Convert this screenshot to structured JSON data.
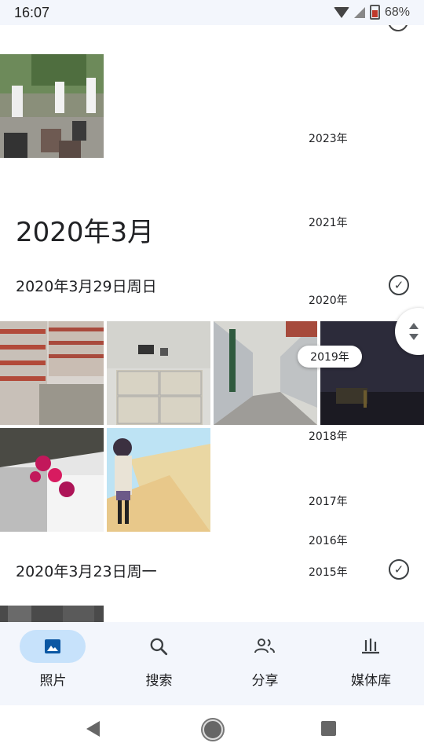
{
  "status_bar": {
    "time": "16:07",
    "battery": "68%",
    "icons": [
      "wifi-icon",
      "cellular-icon",
      "battery-icon"
    ]
  },
  "sections": [
    {
      "month": "2020年3月",
      "days": [
        {
          "label": "2020年3月29日周日",
          "photo_count": 6
        },
        {
          "label": "2020年3月23日周一",
          "photo_count": 1
        }
      ]
    }
  ],
  "year_scrubber": {
    "years": [
      "2023年",
      "2021年",
      "2020年",
      "2019年",
      "2018年",
      "2017年",
      "2016年",
      "2015年"
    ],
    "active": "2019年"
  },
  "bottom_nav": {
    "items": [
      {
        "label": "照片",
        "icon": "photo-icon",
        "active": true
      },
      {
        "label": "搜索",
        "icon": "search-icon",
        "active": false
      },
      {
        "label": "分享",
        "icon": "people-icon",
        "active": false
      },
      {
        "label": "媒体库",
        "icon": "library-icon",
        "active": false
      }
    ]
  },
  "colors": {
    "nav_bg": "#f3f6fc",
    "active_pill": "#c7e2fb",
    "text": "#202124"
  }
}
